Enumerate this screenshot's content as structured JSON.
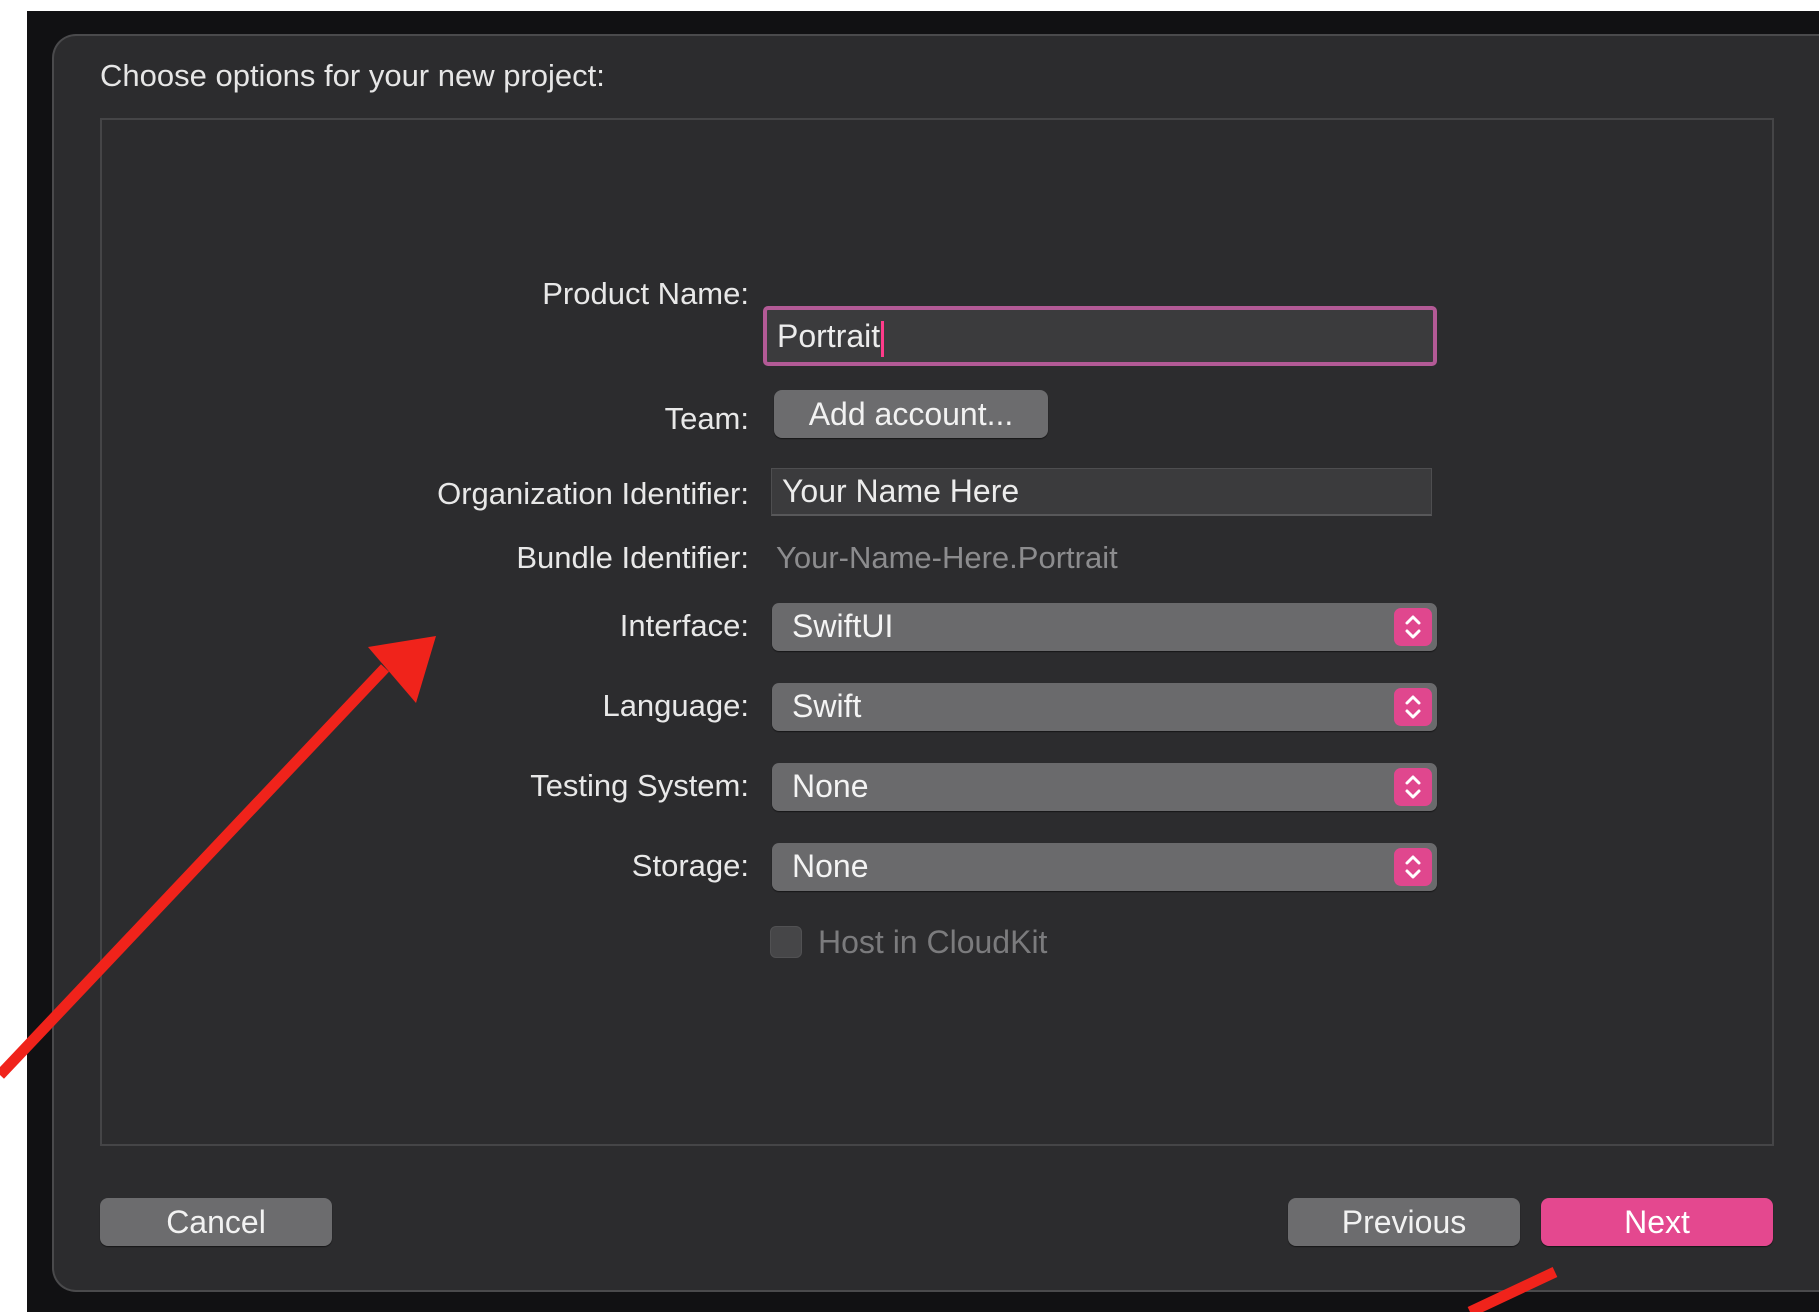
{
  "dialog": {
    "title": "Choose options for your new project:"
  },
  "form": {
    "product_name": {
      "label": "Product Name:",
      "value": "Portrait"
    },
    "team": {
      "label": "Team:",
      "button_label": "Add account..."
    },
    "organization_identifier": {
      "label": "Organization Identifier:",
      "value": "Your Name Here"
    },
    "bundle_identifier": {
      "label": "Bundle Identifier:",
      "value": "Your-Name-Here.Portrait"
    },
    "interface": {
      "label": "Interface:",
      "value": "SwiftUI"
    },
    "language": {
      "label": "Language:",
      "value": "Swift"
    },
    "testing_system": {
      "label": "Testing System:",
      "value": "None"
    },
    "storage": {
      "label": "Storage:",
      "value": "None"
    },
    "host_in_cloudkit": {
      "label": "Host in CloudKit",
      "checked": false,
      "enabled": false
    }
  },
  "footer": {
    "cancel_label": "Cancel",
    "previous_label": "Previous",
    "next_label": "Next"
  },
  "colors": {
    "accent": "#e4488f",
    "focus_ring": "#b35a96",
    "sheet_background": "#2c2c2e",
    "annotation_arrow": "#f0231b"
  },
  "icons": {
    "popup_stepper": "chevron-up-down-icon",
    "annotation": "red-arrow-annotation"
  }
}
